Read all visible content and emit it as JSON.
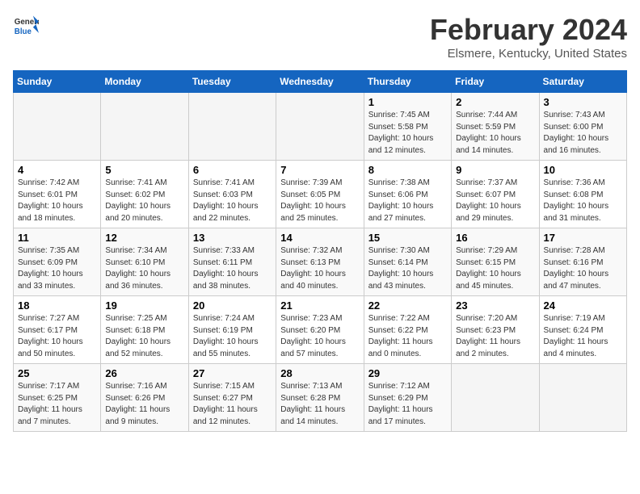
{
  "header": {
    "logo_line1": "General",
    "logo_line2": "Blue",
    "title": "February 2024",
    "subtitle": "Elsmere, Kentucky, United States"
  },
  "days_of_week": [
    "Sunday",
    "Monday",
    "Tuesday",
    "Wednesday",
    "Thursday",
    "Friday",
    "Saturday"
  ],
  "weeks": [
    [
      {
        "day": "",
        "info": ""
      },
      {
        "day": "",
        "info": ""
      },
      {
        "day": "",
        "info": ""
      },
      {
        "day": "",
        "info": ""
      },
      {
        "day": "1",
        "info": "Sunrise: 7:45 AM\nSunset: 5:58 PM\nDaylight: 10 hours\nand 12 minutes."
      },
      {
        "day": "2",
        "info": "Sunrise: 7:44 AM\nSunset: 5:59 PM\nDaylight: 10 hours\nand 14 minutes."
      },
      {
        "day": "3",
        "info": "Sunrise: 7:43 AM\nSunset: 6:00 PM\nDaylight: 10 hours\nand 16 minutes."
      }
    ],
    [
      {
        "day": "4",
        "info": "Sunrise: 7:42 AM\nSunset: 6:01 PM\nDaylight: 10 hours\nand 18 minutes."
      },
      {
        "day": "5",
        "info": "Sunrise: 7:41 AM\nSunset: 6:02 PM\nDaylight: 10 hours\nand 20 minutes."
      },
      {
        "day": "6",
        "info": "Sunrise: 7:41 AM\nSunset: 6:03 PM\nDaylight: 10 hours\nand 22 minutes."
      },
      {
        "day": "7",
        "info": "Sunrise: 7:39 AM\nSunset: 6:05 PM\nDaylight: 10 hours\nand 25 minutes."
      },
      {
        "day": "8",
        "info": "Sunrise: 7:38 AM\nSunset: 6:06 PM\nDaylight: 10 hours\nand 27 minutes."
      },
      {
        "day": "9",
        "info": "Sunrise: 7:37 AM\nSunset: 6:07 PM\nDaylight: 10 hours\nand 29 minutes."
      },
      {
        "day": "10",
        "info": "Sunrise: 7:36 AM\nSunset: 6:08 PM\nDaylight: 10 hours\nand 31 minutes."
      }
    ],
    [
      {
        "day": "11",
        "info": "Sunrise: 7:35 AM\nSunset: 6:09 PM\nDaylight: 10 hours\nand 33 minutes."
      },
      {
        "day": "12",
        "info": "Sunrise: 7:34 AM\nSunset: 6:10 PM\nDaylight: 10 hours\nand 36 minutes."
      },
      {
        "day": "13",
        "info": "Sunrise: 7:33 AM\nSunset: 6:11 PM\nDaylight: 10 hours\nand 38 minutes."
      },
      {
        "day": "14",
        "info": "Sunrise: 7:32 AM\nSunset: 6:13 PM\nDaylight: 10 hours\nand 40 minutes."
      },
      {
        "day": "15",
        "info": "Sunrise: 7:30 AM\nSunset: 6:14 PM\nDaylight: 10 hours\nand 43 minutes."
      },
      {
        "day": "16",
        "info": "Sunrise: 7:29 AM\nSunset: 6:15 PM\nDaylight: 10 hours\nand 45 minutes."
      },
      {
        "day": "17",
        "info": "Sunrise: 7:28 AM\nSunset: 6:16 PM\nDaylight: 10 hours\nand 47 minutes."
      }
    ],
    [
      {
        "day": "18",
        "info": "Sunrise: 7:27 AM\nSunset: 6:17 PM\nDaylight: 10 hours\nand 50 minutes."
      },
      {
        "day": "19",
        "info": "Sunrise: 7:25 AM\nSunset: 6:18 PM\nDaylight: 10 hours\nand 52 minutes."
      },
      {
        "day": "20",
        "info": "Sunrise: 7:24 AM\nSunset: 6:19 PM\nDaylight: 10 hours\nand 55 minutes."
      },
      {
        "day": "21",
        "info": "Sunrise: 7:23 AM\nSunset: 6:20 PM\nDaylight: 10 hours\nand 57 minutes."
      },
      {
        "day": "22",
        "info": "Sunrise: 7:22 AM\nSunset: 6:22 PM\nDaylight: 11 hours\nand 0 minutes."
      },
      {
        "day": "23",
        "info": "Sunrise: 7:20 AM\nSunset: 6:23 PM\nDaylight: 11 hours\nand 2 minutes."
      },
      {
        "day": "24",
        "info": "Sunrise: 7:19 AM\nSunset: 6:24 PM\nDaylight: 11 hours\nand 4 minutes."
      }
    ],
    [
      {
        "day": "25",
        "info": "Sunrise: 7:17 AM\nSunset: 6:25 PM\nDaylight: 11 hours\nand 7 minutes."
      },
      {
        "day": "26",
        "info": "Sunrise: 7:16 AM\nSunset: 6:26 PM\nDaylight: 11 hours\nand 9 minutes."
      },
      {
        "day": "27",
        "info": "Sunrise: 7:15 AM\nSunset: 6:27 PM\nDaylight: 11 hours\nand 12 minutes."
      },
      {
        "day": "28",
        "info": "Sunrise: 7:13 AM\nSunset: 6:28 PM\nDaylight: 11 hours\nand 14 minutes."
      },
      {
        "day": "29",
        "info": "Sunrise: 7:12 AM\nSunset: 6:29 PM\nDaylight: 11 hours\nand 17 minutes."
      },
      {
        "day": "",
        "info": ""
      },
      {
        "day": "",
        "info": ""
      }
    ]
  ]
}
